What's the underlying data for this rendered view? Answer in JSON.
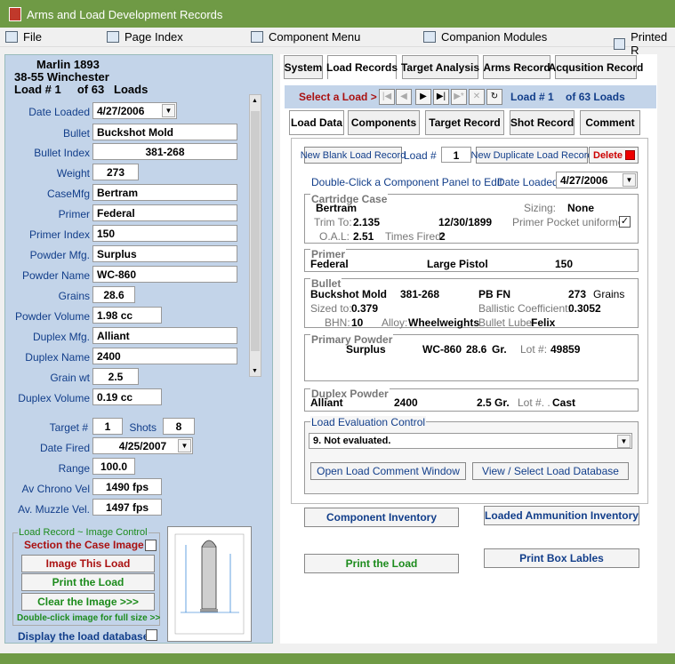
{
  "app": {
    "title": "Arms and Load Development Records"
  },
  "menu": {
    "file": "File",
    "page_index": "Page Index",
    "component_menu": "Component Menu",
    "companion": "Companion Modules",
    "printed": "Printed R"
  },
  "left": {
    "rifle": "Marlin 1893",
    "cartridge": "38-55 Winchester",
    "load_label": "Load #",
    "load_num": "1",
    "of": "of",
    "total": "63",
    "loads": "Loads",
    "fields": [
      {
        "label": "Date Loaded",
        "value": "4/27/2006"
      },
      {
        "label": "Bullet",
        "value": "Buckshot Mold"
      },
      {
        "label": "Bullet Index",
        "value": "381-268"
      },
      {
        "label": "Weight",
        "value": "273"
      },
      {
        "label": "CaseMfg",
        "value": "Bertram"
      },
      {
        "label": "Primer",
        "value": "Federal"
      },
      {
        "label": "Primer Index",
        "value": "150"
      },
      {
        "label": "Powder Mfg.",
        "value": "Surplus"
      },
      {
        "label": "Powder Name",
        "value": "WC-860"
      },
      {
        "label": "Grains",
        "value": "28.6"
      },
      {
        "label": "Powder Volume",
        "value": "1.98 cc"
      },
      {
        "label": "Duplex Mfg.",
        "value": "Alliant"
      },
      {
        "label": "Duplex Name",
        "value": "2400"
      },
      {
        "label": "Grain wt",
        "value": "2.5"
      },
      {
        "label": "Duplex Volume",
        "value": "0.19 cc"
      }
    ],
    "target_label": "Target #",
    "target_value": "1",
    "shots_label": "Shots",
    "shots_value": "8",
    "date_fired_label": "Date Fired",
    "date_fired": "4/25/2007",
    "range_label": "Range",
    "range": "100.0",
    "chrono_label": "Av Chrono Vel",
    "chrono": "1490 fps",
    "muzzle_label": "Av. Muzzle Vel.",
    "muzzle": "1497 fps",
    "image_group": "Load Record ~ Image Control",
    "section_case": "Section the Case Image",
    "image_btn": "Image This Load",
    "print_btn": "Print the Load",
    "clear_btn": "Clear the  Image  >>>",
    "dbl_hint": "Double-click image for full size >>",
    "display_db": "Display the load database"
  },
  "tabs": [
    "System",
    "Load Records",
    "Target Analysis",
    "Arms Record",
    "Acqusition Record"
  ],
  "nav": {
    "select": "Select a Load >",
    "load_label": "Load #",
    "load_num": "1",
    "of": "of",
    "count": "63 Loads"
  },
  "subtabs": [
    "Load Data",
    "Components",
    "Target Record",
    "Shot Record",
    "Comment"
  ],
  "record": {
    "new_blank": "New Blank Load Record",
    "load_hash": "Load  #",
    "load_num": "1",
    "new_dup": "New Duplicate Load Record",
    "delete": "Delete",
    "dbl_click": "Double-Click a Component Panel to Edit",
    "date_loaded_lbl": "Date Loaded",
    "date_loaded": "4/27/2006",
    "case_title": "Cartridge Case",
    "case_mfg": "Bertram",
    "sizing_lbl": "Sizing:",
    "sizing": "None",
    "trim_lbl": "Trim To:",
    "trim": "2.135",
    "trim_date": "12/30/1899",
    "pocket_lbl": "Primer Pocket uniformed",
    "oal_lbl": "O.A.L:",
    "oal": "2.51",
    "fired_lbl": "Times Fired:",
    "fired": "2",
    "primer_title": "Primer",
    "primer_mfg": "Federal",
    "primer_type": "Large Pistol",
    "primer_idx": "150",
    "bullet_title": "Bullet",
    "bullet_name": "Buckshot Mold",
    "bullet_idx": "381-268",
    "bullet_type": "PB FN",
    "bullet_wt": "273",
    "bullet_unit": "Grains",
    "sized_lbl": "Sized to:",
    "sized": "0.379",
    "bc_lbl": "Ballistic Coefficient:",
    "bc": "0.3052",
    "bhn_lbl": "BHN:",
    "bhn": "10",
    "alloy_lbl": "Alloy:",
    "alloy": "Wheelweights",
    "lube_lbl": "Bullet Lube:",
    "lube": "Felix",
    "powder_title": "Primary Powder",
    "powder_mfg": "Surplus",
    "powder_name": "WC-860",
    "powder_gr": "28.6",
    "powder_unit": "Gr.",
    "lot_lbl": "Lot #:",
    "lot": "49859",
    "duplex_title": "Duplex Powder",
    "duplex_mfg": "Alliant",
    "duplex_name": "2400",
    "duplex_gr": "2.5",
    "duplex_unit": "Gr.",
    "dlot_lbl": "Lot #. .",
    "dlot": "Cast",
    "eval_title": "Load Evaluation Control",
    "eval": "9. Not evaluated.",
    "open_comment": "Open Load Comment Window",
    "view_db": "View / Select Load Database"
  },
  "bottom": {
    "component_inv": "Component Inventory",
    "loaded_inv": "Loaded Ammunition Inventory",
    "print_load": "Print the Load",
    "print_labels": "Print Box Lables"
  }
}
